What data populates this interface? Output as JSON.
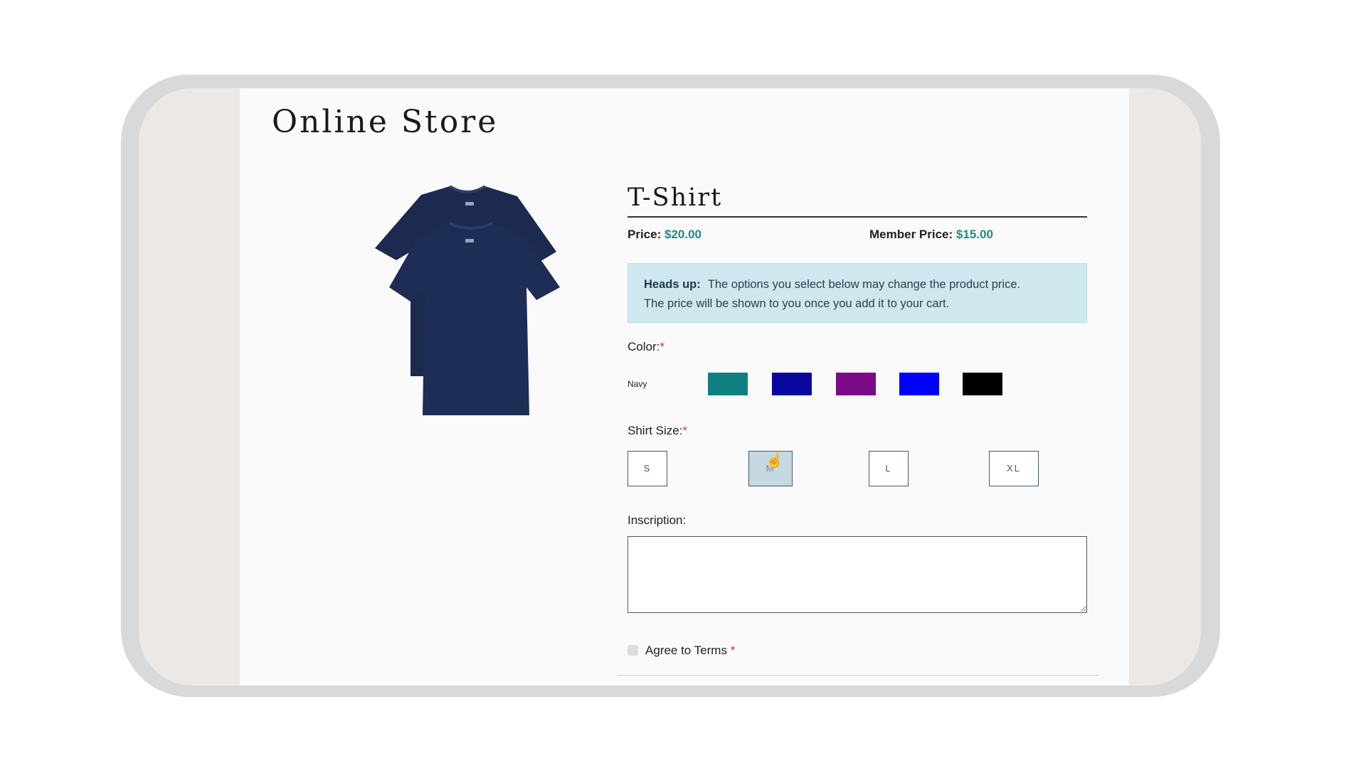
{
  "store": {
    "title": "Online Store"
  },
  "product": {
    "name": "T-Shirt",
    "image_icon": "navy-tshirts-image",
    "price_label": "Price:",
    "price": "$20.00",
    "member_price_label": "Member Price:",
    "member_price": "$15.00"
  },
  "alert": {
    "heading": "Heads up:",
    "line1": "The options you select below may change the product price.",
    "line2": "The price will be shown to you once you add it to your cart."
  },
  "color": {
    "label": "Color:",
    "required_mark": "*",
    "selected": "Navy",
    "swatches": [
      "#0f8080",
      "#07079e",
      "#7b0a86",
      "#0000ff",
      "#000000"
    ]
  },
  "size": {
    "label": "Shirt Size:",
    "required_mark": "*",
    "options": [
      "S",
      "M",
      "L",
      "XL"
    ],
    "hovered": "M"
  },
  "inscription": {
    "label": "Inscription:",
    "value": ""
  },
  "terms": {
    "label": "Agree to Terms",
    "required_mark": "*"
  },
  "colors": {
    "accent": "#1f8a8a",
    "alert_bg": "#cfe8ef",
    "required": "#c0392b"
  }
}
